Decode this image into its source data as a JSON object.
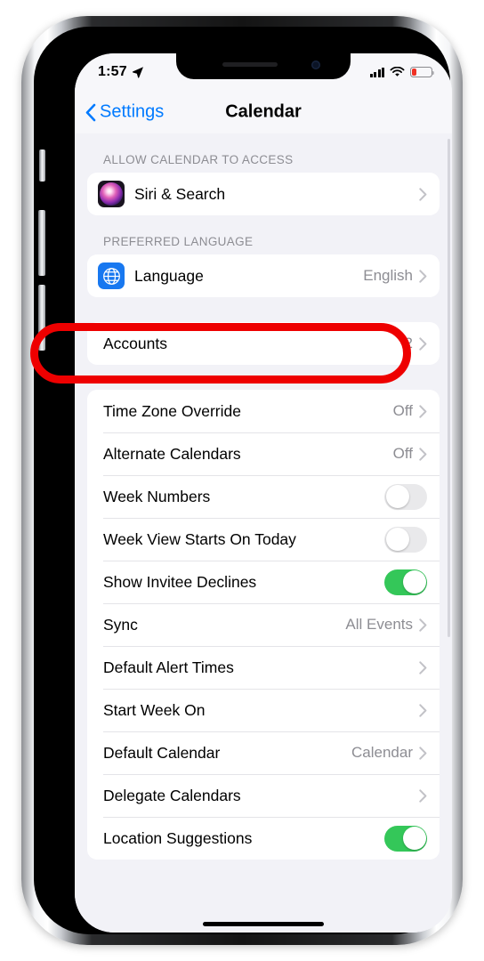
{
  "status_bar": {
    "time": "1:57",
    "location_icon": "location-arrow-icon",
    "signal_icon": "cellular-signal-icon",
    "wifi_icon": "wifi-icon",
    "battery_icon": "battery-low-icon",
    "battery_level_percent": 22
  },
  "nav_bar": {
    "back_label": "Settings",
    "back_icon": "chevron-left-icon",
    "title": "Calendar"
  },
  "colors": {
    "accent_blue": "#007aff",
    "toggle_on_green": "#34c759",
    "annotation_red": "#ee0000",
    "value_gray": "#8d8d93",
    "group_bg": "#f2f2f7"
  },
  "sections": [
    {
      "header": "ALLOW CALENDAR TO ACCESS",
      "rows": [
        {
          "label": "Siri & Search",
          "value": "",
          "icon": "siri-icon",
          "accessory": "chevron"
        }
      ]
    },
    {
      "header": "PREFERRED LANGUAGE",
      "rows": [
        {
          "label": "Language",
          "value": "English",
          "icon": "globe-icon",
          "accessory": "chevron"
        }
      ]
    },
    {
      "header": "",
      "highlighted": true,
      "rows": [
        {
          "label": "Accounts",
          "value": "2",
          "icon": "",
          "accessory": "chevron"
        }
      ]
    },
    {
      "header": "",
      "rows": [
        {
          "label": "Time Zone Override",
          "value": "Off",
          "icon": "",
          "accessory": "chevron"
        },
        {
          "label": "Alternate Calendars",
          "value": "Off",
          "icon": "",
          "accessory": "chevron"
        },
        {
          "label": "Week Numbers",
          "value": "",
          "icon": "",
          "accessory": "toggle",
          "toggle_on": false
        },
        {
          "label": "Week View Starts On Today",
          "value": "",
          "icon": "",
          "accessory": "toggle",
          "toggle_on": false
        },
        {
          "label": "Show Invitee Declines",
          "value": "",
          "icon": "",
          "accessory": "toggle",
          "toggle_on": true
        },
        {
          "label": "Sync",
          "value": "All Events",
          "icon": "",
          "accessory": "chevron"
        },
        {
          "label": "Default Alert Times",
          "value": "",
          "icon": "",
          "accessory": "chevron"
        },
        {
          "label": "Start Week On",
          "value": "",
          "icon": "",
          "accessory": "chevron"
        },
        {
          "label": "Default Calendar",
          "value": "Calendar",
          "icon": "",
          "accessory": "chevron"
        },
        {
          "label": "Delegate Calendars",
          "value": "",
          "icon": "",
          "accessory": "chevron"
        },
        {
          "label": "Location Suggestions",
          "value": "",
          "icon": "",
          "accessory": "toggle",
          "toggle_on": true
        }
      ]
    }
  ]
}
